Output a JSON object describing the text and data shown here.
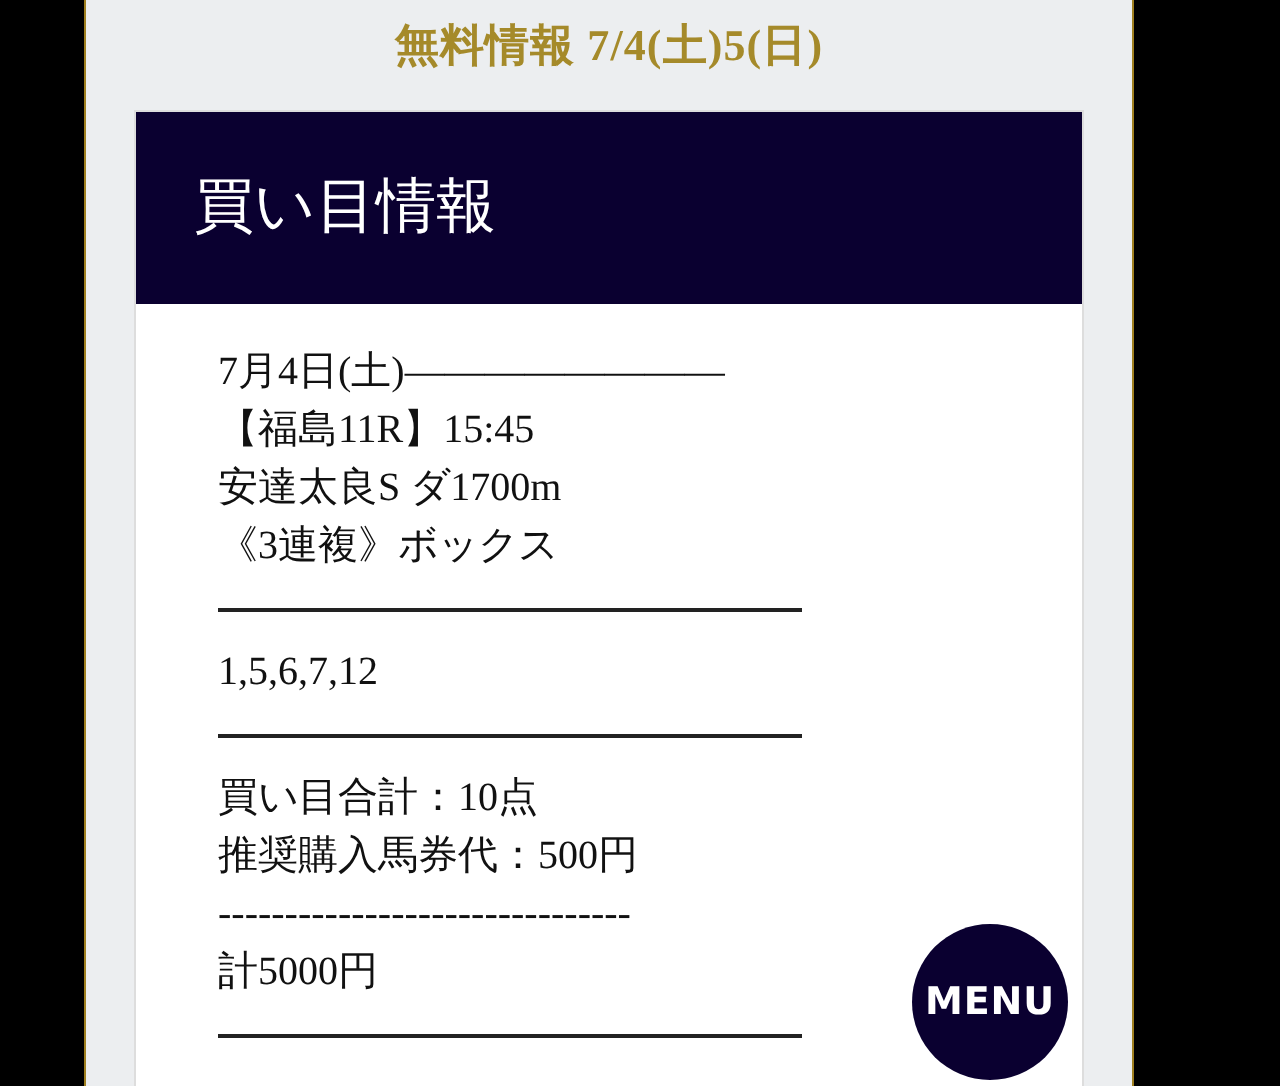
{
  "heading": "無料情報 7/4(土)5(日)",
  "card": {
    "title": "買い目情報",
    "lines": [
      {
        "kind": "text",
        "text": "7月4日(土)――――――――"
      },
      {
        "kind": "text",
        "text": "【福島11R】15:45"
      },
      {
        "kind": "text",
        "text": "安達太良S ダ1700m"
      },
      {
        "kind": "text",
        "text": "《3連複》ボックス"
      },
      {
        "kind": "rule"
      },
      {
        "kind": "text",
        "text": "1,5,6,7,12"
      },
      {
        "kind": "rule"
      },
      {
        "kind": "text",
        "text": "買い目合計：10点"
      },
      {
        "kind": "text",
        "text": "推奨購入馬券代：500円"
      },
      {
        "kind": "text",
        "text": "-------------------------------"
      },
      {
        "kind": "text",
        "text": "計5000円"
      },
      {
        "kind": "rule"
      }
    ]
  },
  "menu_button": "MENU"
}
